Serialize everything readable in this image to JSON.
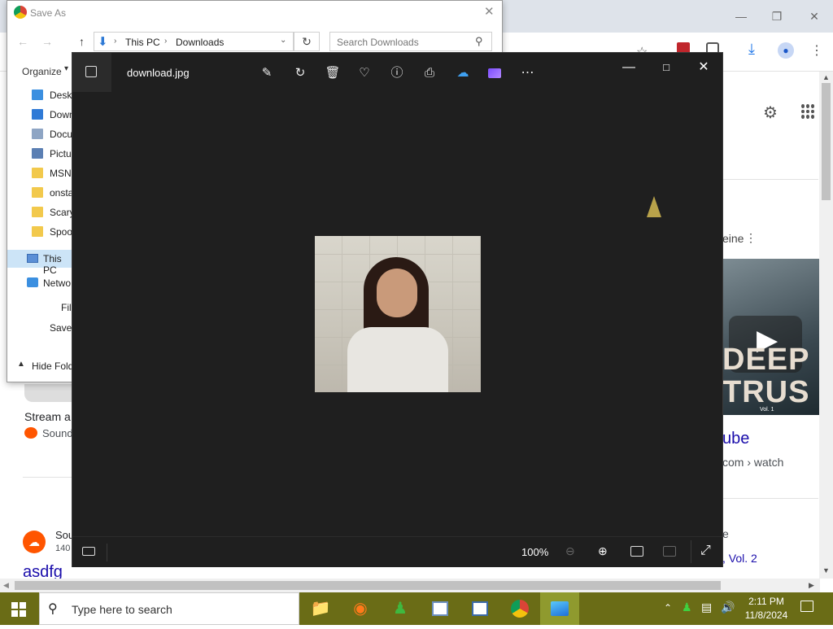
{
  "browser": {
    "page_snippets": {
      "stream_text": "Stream a",
      "soundcloud_text": "Sound",
      "sound_text": "Sou",
      "num_text": "140",
      "asdfg_text": "asdfg",
      "eine_text": "eine",
      "ube_text": "ube",
      "com_watch": "com › watch",
      "e_text": "e",
      "vol2_text": ", Vol. 2",
      "thumb_title": "DEEP TRUS",
      "thumb_sub": "Vol. 1"
    },
    "profile_icon": "person-icon",
    "download_icon": "download-icon"
  },
  "save_as": {
    "title": "Save As",
    "breadcrumb": [
      "This PC",
      "Downloads"
    ],
    "search_placeholder": "Search Downloads",
    "organize": "Organize",
    "nav_items": [
      {
        "label": "Deskt",
        "color": "#3b8fe0"
      },
      {
        "label": "Down",
        "color": "#2f7ad6"
      },
      {
        "label": "Docu",
        "color": "#8ea5c4"
      },
      {
        "label": "Pictu",
        "color": "#5b7fb3"
      },
      {
        "label": "MSN",
        "color": "#f2c94c"
      },
      {
        "label": "onsta",
        "color": "#f2c94c"
      },
      {
        "label": "Scary",
        "color": "#f2c94c"
      },
      {
        "label": "Spoo",
        "color": "#f2c94c"
      }
    ],
    "this_pc": "This PC",
    "network": "Netwo",
    "file_label": "Fil",
    "save_label": "Save",
    "hide_folders": "Hide Fold"
  },
  "photos": {
    "filename": "download.jpg",
    "zoom": "100%",
    "toolbar_icons": [
      "edit-icon",
      "rotate-icon",
      "delete-icon",
      "favorite-icon",
      "info-icon",
      "print-icon",
      "onedrive-icon",
      "clipchamp-icon",
      "more-icon"
    ]
  },
  "taskbar": {
    "search_placeholder": "Type here to search",
    "time": "2:11 PM",
    "date": "11/8/2024"
  }
}
